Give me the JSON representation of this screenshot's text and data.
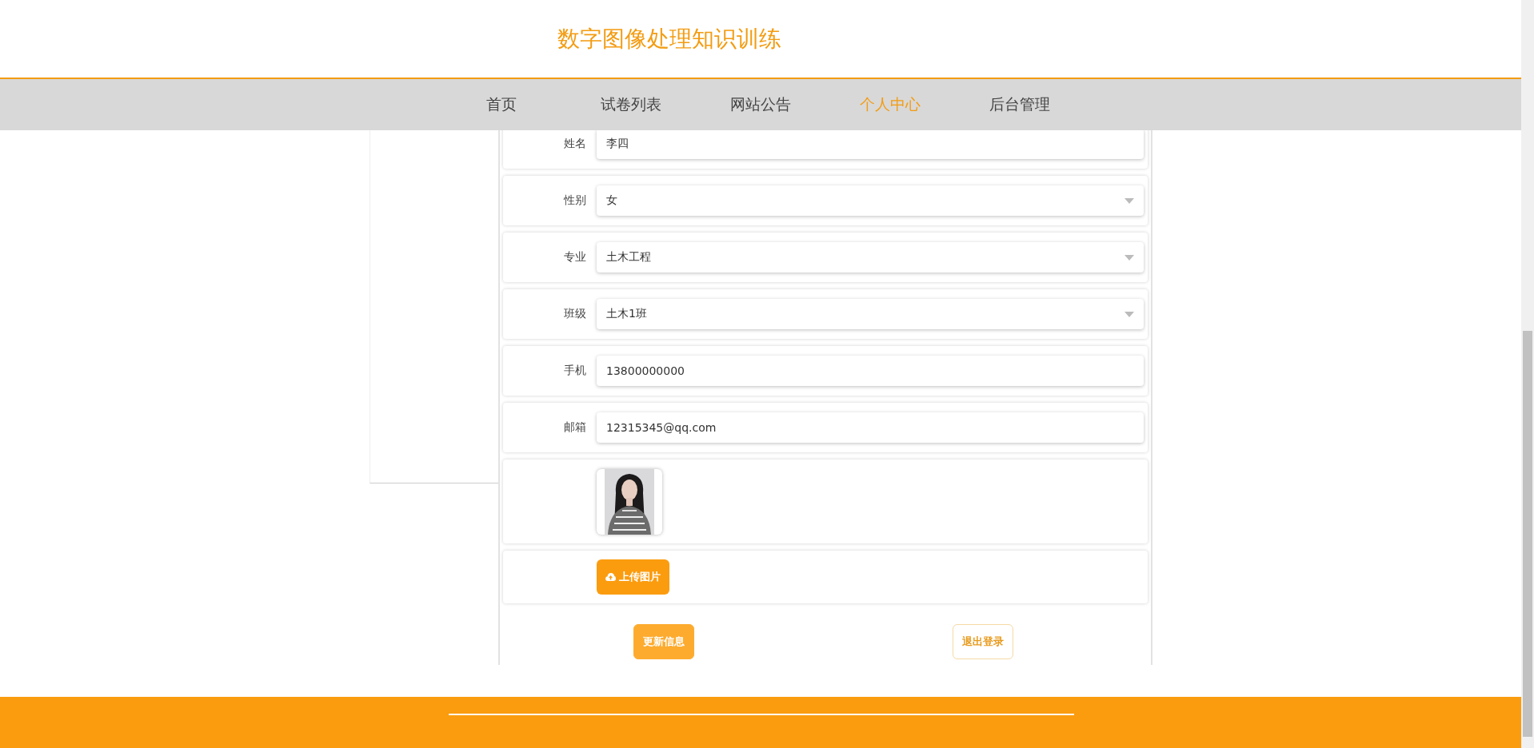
{
  "header": {
    "title": "数字图像处理知识训练"
  },
  "nav": [
    {
      "label": "首页",
      "selected": false
    },
    {
      "label": "试卷列表",
      "selected": false
    },
    {
      "label": "网站公告",
      "selected": false
    },
    {
      "label": "个人中心",
      "selected": true
    },
    {
      "label": "后台管理",
      "selected": false
    }
  ],
  "form": {
    "fields": [
      {
        "kind": "text",
        "label": "姓名",
        "value": "李四"
      },
      {
        "kind": "select",
        "label": "性别",
        "value": "女"
      },
      {
        "kind": "select",
        "label": "专业",
        "value": "土木工程"
      },
      {
        "kind": "select",
        "label": "班级",
        "value": "土木1班"
      },
      {
        "kind": "text",
        "label": "手机",
        "value": "13800000000"
      },
      {
        "kind": "text",
        "label": "邮箱",
        "value": "12315345@qq.com"
      }
    ],
    "upload_button": "上传图片"
  },
  "actions": [
    {
      "kind": "primary",
      "label": "更新信息"
    },
    {
      "kind": "outline",
      "label": "退出登录"
    }
  ]
}
